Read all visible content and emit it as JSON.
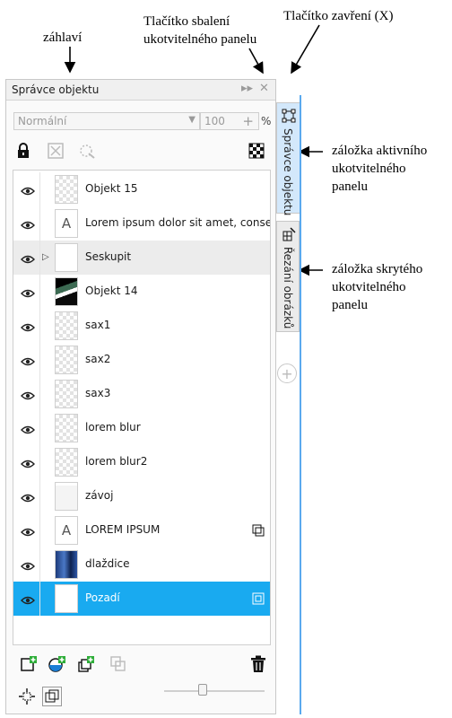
{
  "annotations": {
    "header": "záhlaví",
    "collapse_line1": "Tlačítko sbalení",
    "collapse_line2": "ukotvitelného panelu",
    "close_label": "Tlačítko zavření (X)",
    "active_tab_line1": "záložka aktivního",
    "active_tab_line2": "ukotvitelného",
    "active_tab_line3": "panelu",
    "hidden_tab_line1": "záložka skrytého",
    "hidden_tab_line2": "ukotvitelného",
    "hidden_tab_line3": "panelu"
  },
  "panel": {
    "title": "Správce objektu",
    "collapse_glyph": "▸▸",
    "close_glyph": "✕",
    "blend_mode": "Normální",
    "opacity": "100",
    "opacity_unit": "%"
  },
  "layers": [
    {
      "name": "Objekt 15",
      "thumb": "checker",
      "state": "normal"
    },
    {
      "name": "Lorem ipsum dolor sit amet, consecte...",
      "thumb": "text",
      "state": "normal"
    },
    {
      "name": "Seskupit",
      "thumb": "plain",
      "state": "group"
    },
    {
      "name": "Objekt 14",
      "thumb": "photo",
      "state": "normal"
    },
    {
      "name": "sax1",
      "thumb": "checker",
      "state": "normal"
    },
    {
      "name": "sax2",
      "thumb": "checker",
      "state": "normal"
    },
    {
      "name": "sax3",
      "thumb": "checker",
      "state": "normal"
    },
    {
      "name": "lorem blur",
      "thumb": "checker",
      "state": "normal"
    },
    {
      "name": "lorem blur2",
      "thumb": "checker",
      "state": "normal"
    },
    {
      "name": "závoj",
      "thumb": "veil",
      "state": "normal"
    },
    {
      "name": "LOREM IPSUM",
      "thumb": "text",
      "state": "normal",
      "badge": "clip-icon"
    },
    {
      "name": "dlaždice",
      "thumb": "tiles",
      "state": "normal"
    },
    {
      "name": "Pozadí",
      "thumb": "plain",
      "state": "selected",
      "badge": "lock-bg-icon"
    }
  ],
  "text_thumb_glyph": "A",
  "tabs": {
    "active": "Správce objektu",
    "hidden": "Řezání obrázků"
  },
  "colors": {
    "selection": "#19aaf0",
    "active_tab": "#d3e8fb",
    "accent_line": "#5aa9ee"
  }
}
